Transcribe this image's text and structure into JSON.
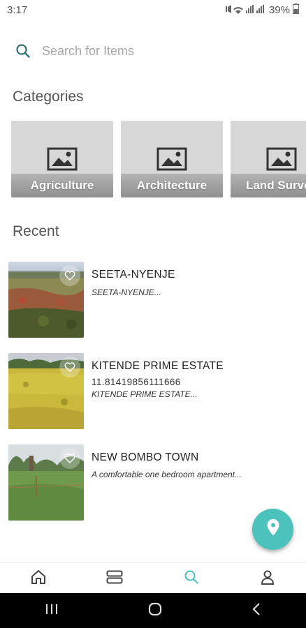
{
  "status": {
    "time": "3:17",
    "battery": "39%",
    "icons": "mute wifi signal"
  },
  "search": {
    "placeholder": "Search for Items",
    "value": ""
  },
  "categories_title": "Categories",
  "categories": [
    {
      "label": "Agriculture"
    },
    {
      "label": "Architecture"
    },
    {
      "label": "Land Survey"
    }
  ],
  "recent_title": "Recent",
  "recent": [
    {
      "title": "SEETA-NYENJE",
      "number": "",
      "description": "SEETA-NYENJE..."
    },
    {
      "title": "KITENDE PRIME ESTATE",
      "number": "11.81419856111666",
      "description": "KITENDE PRIME ESTATE..."
    },
    {
      "title": "NEW BOMBO TOWN",
      "number": "",
      "description": "A comfortable one bedroom apartment..."
    }
  ],
  "colors": {
    "accent": "#4cc2bc",
    "category_bg": "#d7d7d7",
    "nav_icon": "#555555"
  },
  "icons": {
    "fab": "location-pin-icon",
    "nav": [
      "home-icon",
      "list-icon",
      "search-icon",
      "profile-icon"
    ],
    "system_nav": [
      "recents-icon",
      "home-circle-icon",
      "back-icon"
    ]
  }
}
